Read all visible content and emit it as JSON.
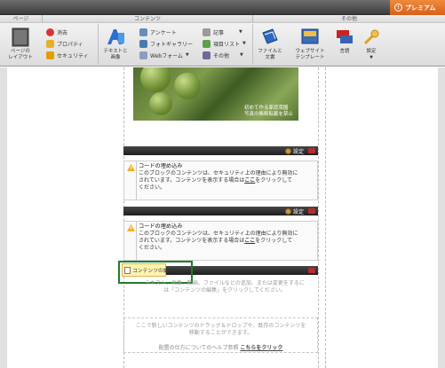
{
  "premium": {
    "label": "プレミアム"
  },
  "ribbon": {
    "groups": [
      {
        "title": "ページ"
      },
      {
        "title": "コンテンツ"
      },
      {
        "title": "その他"
      }
    ],
    "page_group": {
      "layout_label_1": "ページの",
      "layout_label_2": "レイアウト",
      "delete": "消去",
      "property": "プロパティ",
      "security": "セキュリティ"
    },
    "content_group": {
      "text_image_1": "テキストと",
      "text_image_2": "画像",
      "survey": "アンケート",
      "photo_gallery": "フォトギャラリー",
      "web_form": "Webフォーム",
      "article": "記事",
      "item_list": "項目リスト",
      "other": "その他"
    },
    "other_group": {
      "file_doc_1": "ファイルと",
      "file_doc_2": "文書",
      "web_template_1": "ウェブサイト",
      "web_template_2": "テンプレート",
      "language": "言語",
      "settings": "設定"
    }
  },
  "photo": {
    "caption_1": "初めて作る家庭菜園",
    "caption_2": "写真の無断転載を禁止"
  },
  "blocks": [
    {
      "settings_label": "設定",
      "title": "コードの埋め込み",
      "line1": "このブロックのコンテンツは、セキュリティ上の理由により無効に",
      "line2_a": "されています。コンテンツを表示する場合は",
      "line2_link": "ここ",
      "line2_b": "をクリックして",
      "line3": "ください。"
    },
    {
      "settings_label": "設定",
      "title": "コードの埋め込み",
      "line1": "このブロックのコンテンツは、セキュリティ上の理由により無効に",
      "line2_a": "されています。コンテンツを表示する場合は",
      "line2_link": "ここ",
      "line2_b": "をクリックして",
      "line3": "ください。"
    }
  ],
  "content_edit": {
    "button_label": "コンテンツの編集",
    "placeholder_1": "テキスト、画像、動画、ファイルなどの追加、または変更をするに",
    "placeholder_2": "は「コンテンツの編集」をクリックしてください。"
  },
  "dropzone": {
    "line1": "ここで新しいコンテンツのドラッグ＆ドロップや、既存のコンテンツを",
    "line2": "移動することができます。",
    "help_prefix": "配置の仕方についてのヘルプ参照",
    "help_link": "こちらをクリック"
  }
}
